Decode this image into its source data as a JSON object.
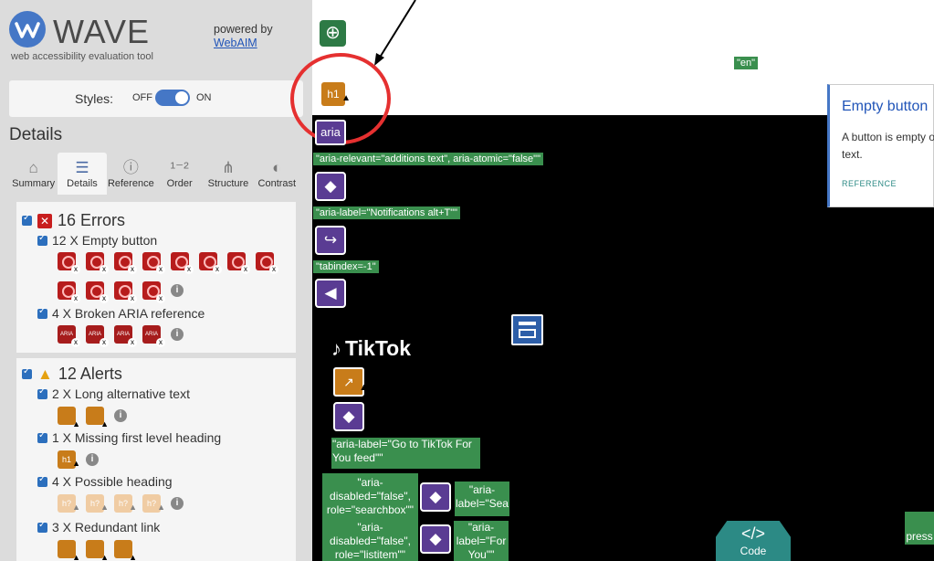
{
  "sidebar": {
    "logo": {
      "word": "WAVE",
      "subtitle": "web accessibility evaluation tool",
      "powered_by": "powered by",
      "webaim": "WebAIM"
    },
    "styles": {
      "label": "Styles:",
      "off": "OFF",
      "on": "ON",
      "value": "ON"
    },
    "details_title": "Details",
    "tabs": [
      {
        "label": "Summary",
        "icon": "home-icon",
        "glyph": "⌂"
      },
      {
        "label": "Details",
        "icon": "list-icon",
        "glyph": "☰",
        "active": true
      },
      {
        "label": "Reference",
        "icon": "info-icon",
        "glyph": "ⓘ"
      },
      {
        "label": "Order",
        "icon": "order-icon",
        "glyph": "¹⁻²"
      },
      {
        "label": "Structure",
        "icon": "structure-icon",
        "glyph": "⋔"
      },
      {
        "label": "Contrast",
        "icon": "contrast-icon",
        "glyph": "◐"
      }
    ],
    "errors": {
      "heading": "16 Errors",
      "items": [
        {
          "label": "12 X Empty button",
          "count": 12
        },
        {
          "label": "4 X Broken ARIA reference",
          "count": 4
        }
      ]
    },
    "alerts": {
      "heading": "12 Alerts",
      "items": [
        {
          "label": "2 X Long alternative text",
          "count": 2
        },
        {
          "label": "1 X Missing first level heading",
          "count": 1
        },
        {
          "label": "4 X Possible heading",
          "count": 4
        },
        {
          "label": "3 X Redundant link",
          "count": 3
        }
      ]
    }
  },
  "page": {
    "lang": "\"en\"",
    "h1": "h1",
    "aria": "aria",
    "tags": {
      "aria_relevant": "\"aria-relevant=\"additions text\", aria-atomic=\"false\"\"",
      "aria_label_notifications": "\"aria-label=\"Notifications alt+T\"\"",
      "tabindex": "\"tabindex=-1\"",
      "aria_label_go": "\"aria-label=\"Go to TikTok For You feed\"\""
    },
    "tiktok": "TikTok",
    "boxes": {
      "b1": "\"aria-disabled=\"false\", role=\"searchbox\"\"",
      "b2": "\"aria-label=\"Sea",
      "b3": "\"aria-disabled=\"false\", role=\"listitem\"\"",
      "b4": "\"aria-label=\"For You\"\"",
      "b5": "press"
    },
    "code_label": "Code",
    "popup": {
      "title": "Empty button",
      "body": "A button is empty or has no value text.",
      "ref": "REFERENCE"
    }
  }
}
